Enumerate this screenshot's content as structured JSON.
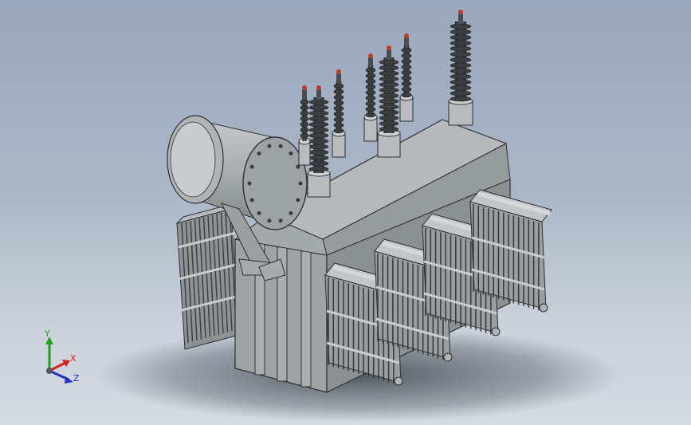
{
  "viewport": {
    "background_top": "#9aa8bd",
    "background_bottom": "#d6dbe2",
    "model_color": "#9ea3a5"
  },
  "triad": {
    "x_label": "X",
    "y_label": "Y",
    "z_label": "Z",
    "x_color": "#d02020",
    "y_color": "#20a020",
    "z_color": "#2030c8"
  }
}
